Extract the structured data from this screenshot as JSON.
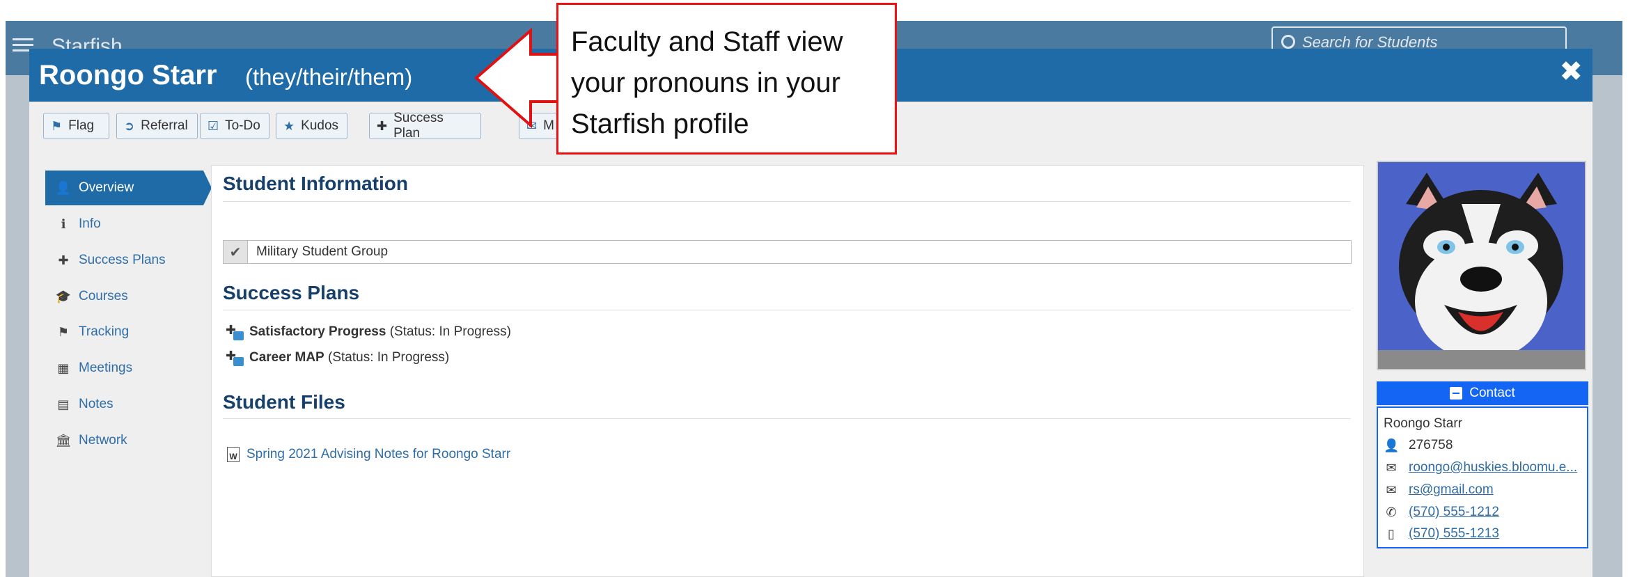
{
  "background": {
    "app_title": "Starfish",
    "search_placeholder": "Search for Students"
  },
  "modal": {
    "student_name": "Roongo Starr",
    "pronouns": "(they/their/them)",
    "close_glyph": "✖"
  },
  "toolbar": {
    "flag": "Flag",
    "referral": "Referral",
    "todo": "To-Do",
    "kudos": "Kudos",
    "success_plan": "Success Plan",
    "message_partial": "M"
  },
  "nav": {
    "items": [
      {
        "label": "Overview",
        "icon": "user-icon",
        "active": true
      },
      {
        "label": "Info",
        "icon": "info-icon"
      },
      {
        "label": "Success Plans",
        "icon": "puzzle-icon"
      },
      {
        "label": "Courses",
        "icon": "graduation-cap-icon"
      },
      {
        "label": "Tracking",
        "icon": "flag-icon"
      },
      {
        "label": "Meetings",
        "icon": "calendar-icon"
      },
      {
        "label": "Notes",
        "icon": "note-icon"
      },
      {
        "label": "Network",
        "icon": "institution-icon"
      }
    ]
  },
  "main": {
    "student_info_title": "Student Information",
    "groups": [
      "Military Student Group"
    ],
    "success_plans_title": "Success Plans",
    "plans": [
      {
        "name": "Satisfactory Progress",
        "status": "(Status: In Progress)"
      },
      {
        "name": "Career MAP",
        "status": "(Status: In Progress)"
      }
    ],
    "files_title": "Student Files",
    "files": [
      "Spring 2021 Advising Notes for Roongo Starr"
    ]
  },
  "contact": {
    "header": "Contact",
    "name": "Roongo Starr",
    "id": "276758",
    "email1": "roongo@huskies.bloomu.e...",
    "email2": "rs@gmail.com",
    "phone": "(570) 555-1212",
    "mobile": "(570) 555-1213"
  },
  "callout": {
    "text": "Faculty and Staff view your pronouns in your Starfish profile",
    "border_color": "#e11111"
  },
  "colors": {
    "header_blue": "#1e6ba8",
    "contact_blue": "#1565f5",
    "title_navy": "#16406a"
  }
}
